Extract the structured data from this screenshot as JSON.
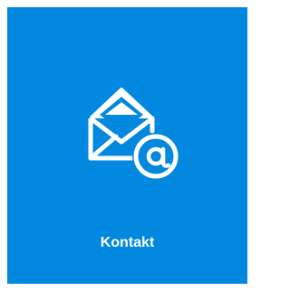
{
  "tile": {
    "label": "Kontakt",
    "icon": "envelope-at-icon",
    "background_color": "#0288df",
    "text_color": "#ffffff"
  }
}
